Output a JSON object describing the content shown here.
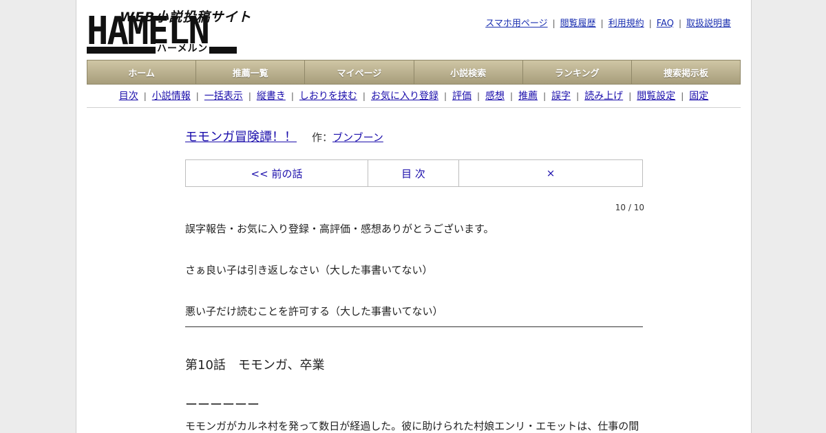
{
  "logo": {
    "tagline": "WEB小説投稿サイト",
    "wordmark": "HAMELN",
    "kana": "ハーメルン"
  },
  "top_links": [
    "スマホ用ページ",
    "閲覧履歴",
    "利用規約",
    "FAQ",
    "取扱説明書"
  ],
  "main_nav": [
    "ホーム",
    "推薦一覧",
    "マイページ",
    "小説検索",
    "ランキング",
    "捜索掲示板"
  ],
  "sub_nav": [
    "目次",
    "小説情報",
    "一括表示",
    "縦書き",
    "しおりを挟む",
    "お気に入り登録",
    "評価",
    "感想",
    "推薦",
    "誤字",
    "読み上げ",
    "閲覧設定",
    "固定"
  ],
  "novel": {
    "title": "モモンガ冒険譚！！",
    "by_label": "作：",
    "author": "ブンブーン"
  },
  "pager": {
    "prev": "<< 前の話",
    "toc": "目 次",
    "next": "×"
  },
  "episode_count": "10 / 10",
  "preface": [
    "誤字報告・お気に入り登録・高評価・感想ありがとうございます。",
    "さぁ良い子は引き返しなさい（大した事書いてない）",
    "悪い子だけ読むことを許可する（大した事書いてない）"
  ],
  "chapter_title": "第10話　モモンガ、卒業",
  "body": [
    "ーーーーーー",
    "モモンガがカルネ村を発って数日が経過した。彼に助けられた村娘エンリ・エモットは、仕事の間"
  ]
}
